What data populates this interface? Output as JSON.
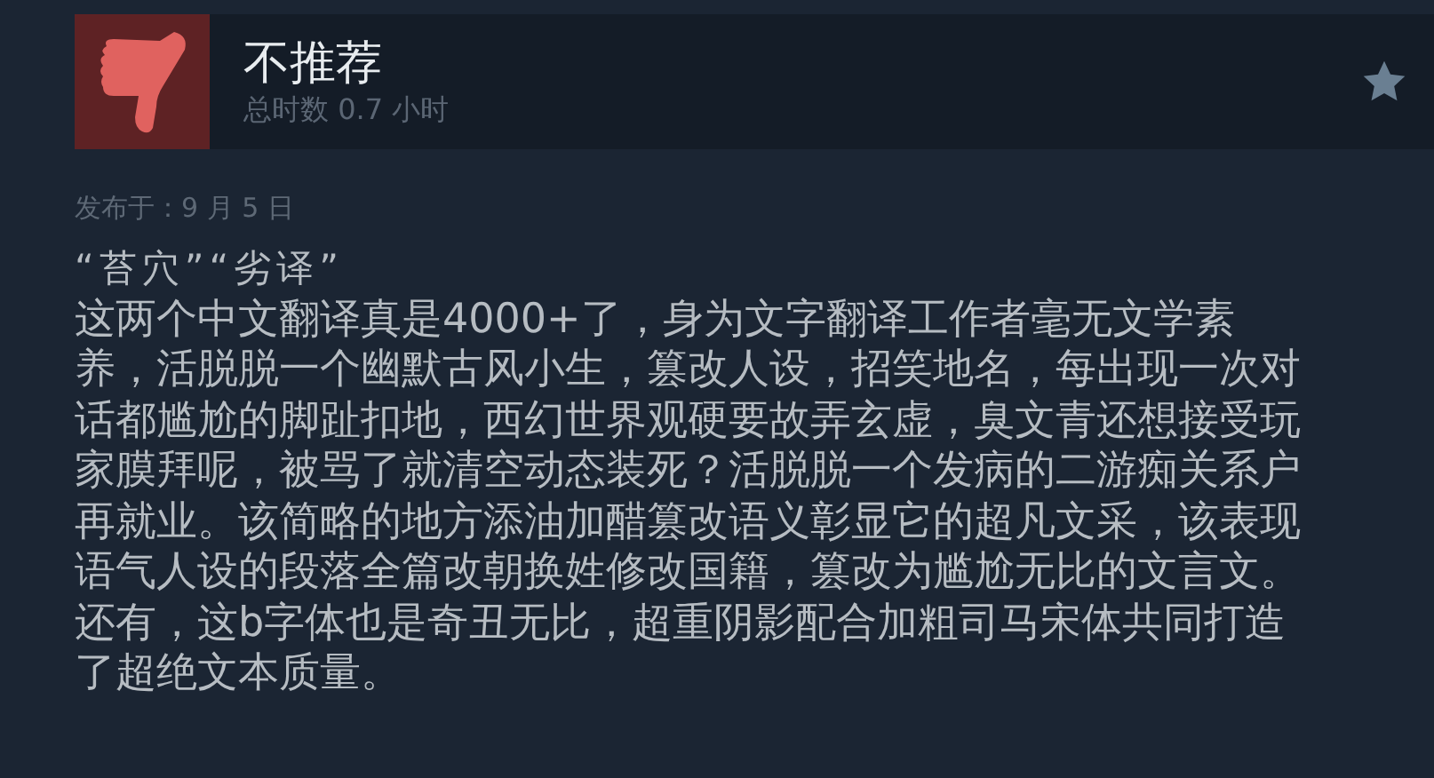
{
  "review": {
    "verdict": "不推荐",
    "recommended": false,
    "hours": "总时数 0.7 小时",
    "posted": "发布于：9 月 5 日",
    "title": "“苔穴”“劣译”",
    "body_lines": [
      "这两个中文翻译真是4000+了，身为文字翻译工作者毫无文学素",
      "养，活脱脱一个幽默古风小生，篡改人设，招笑地名，每出现一次对",
      "话都尴尬的脚趾扣地，西幻世界观硬要故弄玄虚，臭文青还想接受玩",
      "家膜拜呢，被骂了就清空动态装死？活脱脱一个发病的二游痴关系户",
      "再就业。该简略的地方添油加醋篡改语义彰显它的超凡文采，该表现",
      "语气人设的段落全篇改朝换姓修改国籍，篡改为尴尬无比的文言文。",
      "还有，这b字体也是奇丑无比，超重阴影配合加粗司马宋体共同打造",
      "了超绝文本质量。"
    ]
  }
}
